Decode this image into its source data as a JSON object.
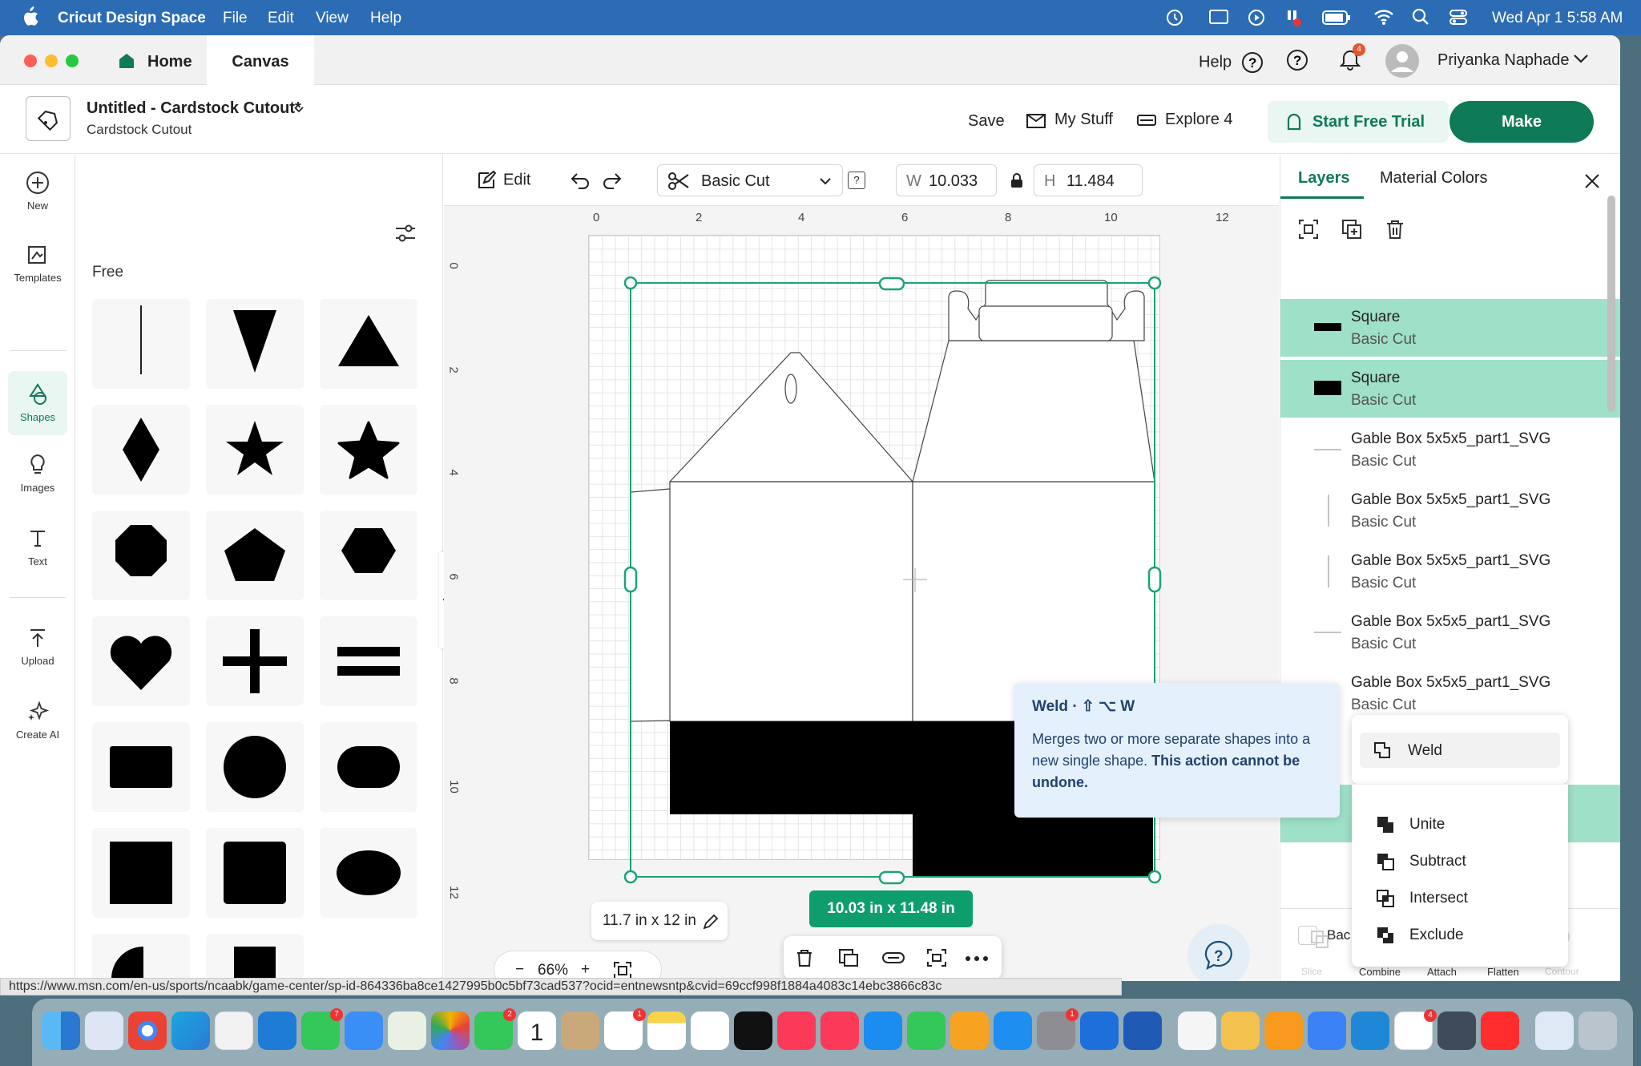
{
  "menubar": {
    "apple": "",
    "app": "Cricut Design Space",
    "items": [
      "File",
      "Edit",
      "View",
      "Help"
    ],
    "datetime": "Wed Apr 1  5:58 AM"
  },
  "tabs": {
    "home": "Home",
    "canvas": "Canvas",
    "help": "Help",
    "notif_count": "4",
    "user": "Priyanka Naphade"
  },
  "project": {
    "title": "Untitled - Cardstock Cutout*",
    "subtitle": "Cardstock Cutout",
    "save": "Save",
    "mystuff": "My Stuff",
    "explore": "Explore 4",
    "trial": "Start Free Trial",
    "make": "Make"
  },
  "nav": [
    "New",
    "Templates",
    "Shapes",
    "Images",
    "Text",
    "Upload",
    "Create AI"
  ],
  "shapes_panel": {
    "section": "Free"
  },
  "toolbar": {
    "edit": "Edit",
    "operation": "Basic Cut",
    "help": "?",
    "w_label": "W",
    "w_value": "10.033",
    "h_label": "H",
    "h_value": "11.484"
  },
  "ruler": {
    "top": [
      "0",
      "2",
      "4",
      "6",
      "8",
      "10",
      "12"
    ],
    "left": [
      "0",
      "2",
      "4",
      "6",
      "8",
      "10",
      "12"
    ]
  },
  "canvas": {
    "mat_size": "11.7 in x 12 in",
    "zoom": "66%",
    "zoom_minus": "−",
    "zoom_plus": "+",
    "dims": "10.03  in x 11.48  in"
  },
  "right_panel": {
    "tab_layers": "Layers",
    "tab_colors": "Material Colors",
    "layers": [
      {
        "name": "Square",
        "op": "Basic Cut"
      },
      {
        "name": "Square",
        "op": "Basic Cut"
      },
      {
        "name": "Gable Box 5x5x5_part1_SVG",
        "op": "Basic Cut"
      },
      {
        "name": "Gable Box 5x5x5_part1_SVG",
        "op": "Basic Cut"
      },
      {
        "name": "Gable Box 5x5x5_part1_SVG",
        "op": "Basic Cut"
      },
      {
        "name": "Gable Box 5x5x5_part1_SVG",
        "op": "Basic Cut"
      },
      {
        "name": "Gable Box 5x5x5_part1_SVG",
        "op": "Basic Cut"
      }
    ],
    "back_label": "Bac",
    "bottom": [
      "Slice",
      "Combine",
      "Attach",
      "Flatten",
      "Contour"
    ]
  },
  "tooltip": {
    "title": "Weld · ⇧ ⌥ W",
    "desc": "Merges two or more separate shapes into a new single shape. ",
    "warn": "This action cannot be undone."
  },
  "menu": {
    "weld": "Weld",
    "unite": "Unite",
    "subtract": "Subtract",
    "intersect": "Intersect",
    "exclude": "Exclude"
  },
  "status_url": "https://www.msn.com/en-us/sports/ncaabk/game-center/sp-id-864336ba8ce1427995b0c5bf73cad537?ocid=entnewsntp&cvid=69ccf998f1884a4083c14ebc3866c83c",
  "dock": {
    "badges": [
      "7",
      "2",
      "1",
      "1",
      "4"
    ],
    "calendar_day": "1"
  }
}
